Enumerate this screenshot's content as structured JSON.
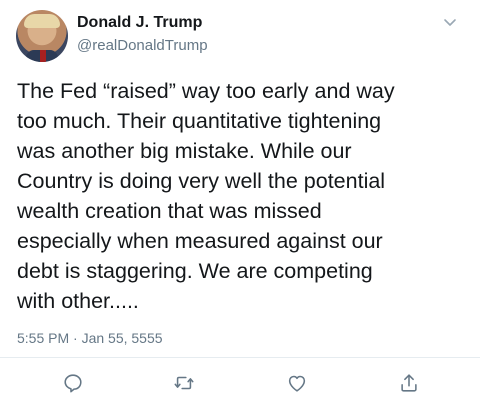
{
  "tweet": {
    "author_name": "Donald J. Trump",
    "author_handle": "@realDonaldTrump",
    "text": "The Fed “raised” way too early and way\ntoo much. Their quantitative tightening\nwas another big mistake. While our\nCountry is doing very well the potential\nwealth creation that was missed\nespecially when measured against our\ndebt is staggering. We are competing\nwith other.....",
    "timestamp": "5:55 PM · Jan 55, 5555"
  },
  "icons": {
    "menu": "chevron-down-icon",
    "reply": "comment-icon",
    "retweet": "retweet-icon",
    "like": "heart-icon",
    "share": "share-icon"
  },
  "colors": {
    "text": "#14171a",
    "muted": "#657786",
    "icon": "#657786",
    "divider": "#e6ecf0"
  }
}
